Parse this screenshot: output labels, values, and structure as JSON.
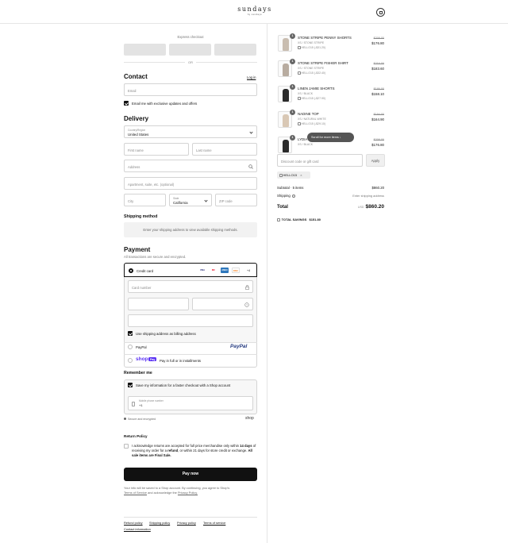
{
  "header": {
    "brand_name": "sundays",
    "brand_sub": "by sundays",
    "cart_icon": "shopping-bag-icon"
  },
  "express": {
    "title": "Express checkout",
    "or": "OR"
  },
  "contact": {
    "title": "Contact",
    "login": "Log in",
    "email_placeholder": "Email",
    "newsletter_label": "Email me with exclusive updates and offers"
  },
  "delivery": {
    "title": "Delivery",
    "country_label": "Country/Region",
    "country_value": "United States",
    "first_name": "First name",
    "last_name": "Last name",
    "address": "Address",
    "apartment": "Apartment, suite, etc. (optional)",
    "city": "City",
    "state_label": "State",
    "state_value": "California",
    "zip": "ZIP code"
  },
  "shipping": {
    "title": "Shipping method",
    "message": "Enter your shipping address to view available shipping methods."
  },
  "payment": {
    "title": "Payment",
    "subtitle": "All transactions are secure and encrypted.",
    "credit_card": "Credit card",
    "card_logos": [
      "VISA",
      "MC",
      "AMEX",
      "DISC"
    ],
    "more_cards": "+4",
    "card_number": "Card number",
    "billing_label": "Use shipping address as billing address",
    "paypal_label": "PayPal",
    "paypal_logo": "PayPal",
    "shoppay_logo": "shop",
    "shoppay_badge": "Pay",
    "shoppay_label": "Pay in full or in installments"
  },
  "remember": {
    "title": "Remember me",
    "save_label": "Save my information for a faster checkout with a Shop account",
    "phone_label": "Mobile phone number",
    "phone_value": "+1",
    "secure_note": "Secure and encrypted",
    "shop_logo": "shop"
  },
  "return_policy": {
    "title": "Return Policy",
    "text_1": "I acknowledge returns are accepted for full price merchandise only within",
    "text_1_bold": "14",
    "text_2_bold": "days",
    "text_2": "of receiving my order for a",
    "text_2_bold2": "refund",
    "text_2b": ", or within 21 days for store credit or",
    "text_3": "exchange.",
    "text_3_bold": "All sale items are Final Sale."
  },
  "pay_now": "Pay now",
  "shop_notice": {
    "line1": "Your info will be saved to a Shop account. By continuing, you agree to Shop's",
    "terms": "Terms of Service",
    "line2": "and acknowledge the",
    "privacy": "Privacy Policy."
  },
  "footer": {
    "links": [
      "Refund policy",
      "Shipping policy",
      "Privacy policy",
      "Terms of service"
    ],
    "contact": "Contact information"
  },
  "order": {
    "items": [
      {
        "qty": "1",
        "name": "STONE STRIPE PENNY SHORTS",
        "variant": "XS / STONE STRIPE",
        "code": "HELLO15 (-$31.20)",
        "old_price": "$208.00",
        "new_price": "$176.80",
        "color": "#c9bdb0"
      },
      {
        "qty": "1",
        "name": "STONE STRIPE FISHER SHIRT",
        "variant": "XS / STONE STRIPE",
        "code": "HELLO15 (-$32.40)",
        "old_price": "$216.00",
        "new_price": "$183.60",
        "color": "#b8aca0"
      },
      {
        "qty": "1",
        "name": "LINEN JAMIE SHORTS",
        "variant": "XS / BLACK",
        "code": "HELLO15 (-$27.90)",
        "old_price": "$186.00",
        "new_price": "$158.10",
        "color": "#2a2a2a"
      },
      {
        "qty": "1",
        "name": "NADINE TOP",
        "variant": "XS / NATURAL WHITE",
        "code": "HELLO15 (-$29.10)",
        "old_price": "$194.00",
        "new_price": "$164.90",
        "color": "#d9c8b5"
      },
      {
        "qty": "1",
        "name": "LYDIA",
        "variant": "XS / BLACK",
        "code": "",
        "old_price": "$208.00",
        "new_price": "$176.80",
        "color": "#2a2a2a"
      }
    ],
    "scroll_hint": "Scroll for more items ↓",
    "discount_placeholder": "Discount code or gift card",
    "apply": "Apply",
    "applied_code": "HELLO15",
    "subtotal_label": "Subtotal · 5 items",
    "subtotal_value": "$860.20",
    "shipping_label": "Shipping",
    "shipping_value": "Enter shipping address",
    "total_label": "Total",
    "total_currency": "USD",
    "total_value": "$860.20",
    "savings_label": "TOTAL SAVINGS",
    "savings_value": "$151.80"
  }
}
